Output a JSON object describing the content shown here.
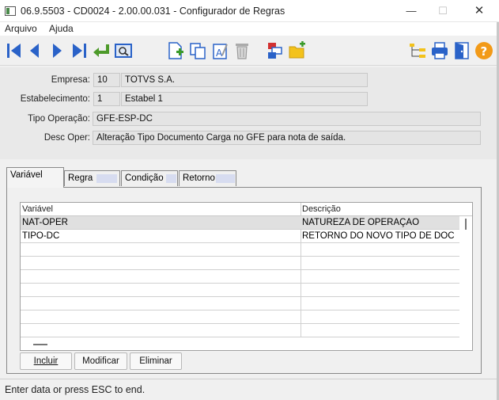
{
  "window": {
    "title": "06.9.5503 - CD0024 - 2.00.00.031 - Configurador de Regras",
    "minimize": "—",
    "maximize": "☐",
    "close": "✕"
  },
  "menu": {
    "items": [
      "Arquivo",
      "Ajuda"
    ]
  },
  "toolbar": {
    "icons": [
      "first-record-icon",
      "previous-record-icon",
      "next-record-icon",
      "last-record-icon",
      "goto-icon",
      "search-icon",
      "new-icon",
      "copy-icon",
      "edit-icon",
      "delete-icon",
      "rules-icon",
      "new-folder-icon",
      "tree-icon",
      "print-icon",
      "exit-icon",
      "help-icon"
    ]
  },
  "form": {
    "empresa_label": "Empresa:",
    "empresa_code": "10",
    "empresa_name": "TOTVS S.A.",
    "estab_label": "Estabelecimento:",
    "estab_code": "1",
    "estab_name": "Estabel 1",
    "tipo_label": "Tipo Operação:",
    "tipo_value": "GFE-ESP-DC",
    "desc_label": "Desc Oper:",
    "desc_value": "Alteração Tipo Documento Carga no GFE para nota de saída."
  },
  "tabs": [
    {
      "label": "Variável",
      "active": true
    },
    {
      "label": "Regra",
      "active": false
    },
    {
      "label": "Condição",
      "active": false
    },
    {
      "label": "Retorno",
      "active": false
    }
  ],
  "grid": {
    "columns": [
      "Variável",
      "Descrição"
    ],
    "rows": [
      {
        "var": "NAT-OPER",
        "desc": "NATUREZA DE OPERAÇÃO"
      },
      {
        "var": "TIPO-DC",
        "desc": "RETORNO DO NOVO TIPO DE DOC"
      }
    ]
  },
  "buttons": {
    "incluir": "Incluir",
    "modificar": "Modificar",
    "eliminar": "Eliminar"
  },
  "status": {
    "text": "Enter data or press ESC to end."
  }
}
